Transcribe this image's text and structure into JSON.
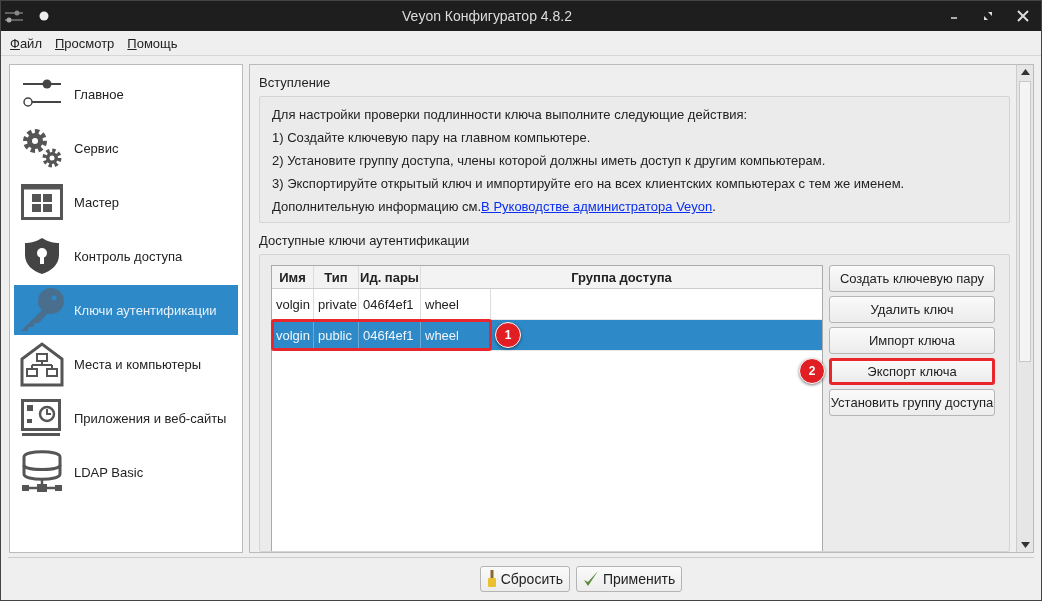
{
  "window": {
    "title": "Veyon Конфигуратор 4.8.2"
  },
  "menu": [
    "Файл",
    "Просмотр",
    "Помощь"
  ],
  "sidebar": {
    "items": [
      {
        "label": "Главное",
        "kind": "sliders",
        "selected": false
      },
      {
        "label": "Сервис",
        "kind": "gears",
        "selected": false
      },
      {
        "label": "Мастер",
        "kind": "grid",
        "selected": false
      },
      {
        "label": "Контроль доступа",
        "kind": "shield",
        "selected": false
      },
      {
        "label": "Ключи аутентификации",
        "kind": "key",
        "selected": true
      },
      {
        "label": "Места и компьютеры",
        "kind": "house",
        "selected": false
      },
      {
        "label": "Приложения и веб-сайты",
        "kind": "screen",
        "selected": false
      },
      {
        "label": "LDAP Basic",
        "kind": "database",
        "selected": false
      }
    ]
  },
  "intro": {
    "title": "Вступление",
    "lines": [
      "Для настройки проверки подлинности ключа выполните следующие действия:",
      "1) Создайте ключевую пару на главном компьютере.",
      "2) Установите группу доступа, члены которой должны иметь доступ к другим компьютерам.",
      "3) Экспортируйте открытый ключ и импортируйте его на всех клиентских компьютерах с тем же именем."
    ],
    "more_text": "Дополнительную информацию см.",
    "more_link": "В Руководстве администратора Veyon",
    "more_end": "."
  },
  "keys": {
    "title": "Доступные ключи аутентификации",
    "table": {
      "columns": [
        "Имя",
        "Тип",
        "Ид. пары",
        "Группа доступа"
      ],
      "rows": [
        {
          "cells": [
            "volgin",
            "private",
            "046f4ef1",
            "wheel"
          ],
          "selected": false,
          "highlighted": false
        },
        {
          "cells": [
            "volgin",
            "public",
            "046f4ef1",
            "wheel"
          ],
          "selected": true,
          "highlighted": true,
          "badge": "1"
        }
      ]
    },
    "buttons": [
      {
        "label": "Создать ключевую пару",
        "highlighted": false
      },
      {
        "label": "Удалить ключ",
        "highlighted": false
      },
      {
        "label": "Импорт ключа",
        "highlighted": false
      },
      {
        "label": "Экспорт ключа",
        "highlighted": true,
        "badge": "2"
      },
      {
        "label": "Установить группу доступа",
        "highlighted": false
      }
    ]
  },
  "footer": {
    "buttons": [
      {
        "label": "Сбросить",
        "kind": "reset"
      },
      {
        "label": "Применить",
        "kind": "apply"
      }
    ]
  }
}
